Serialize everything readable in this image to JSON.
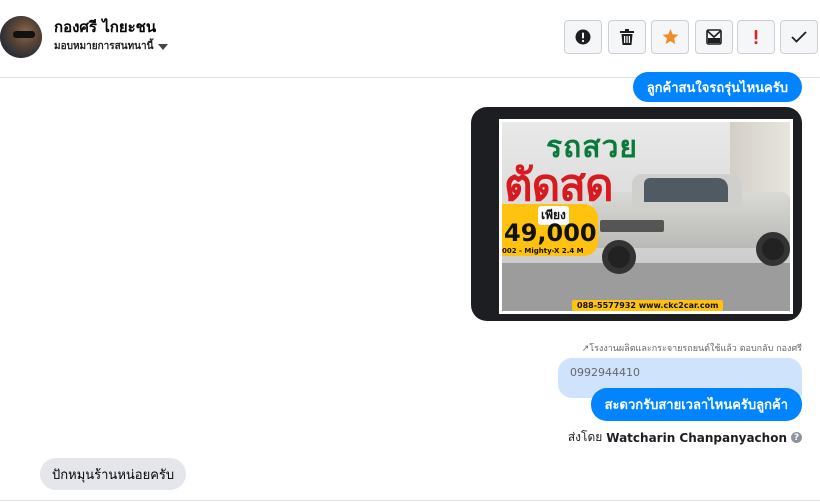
{
  "header": {
    "contact_name": "กองศรี ไกยะชน",
    "assign_label": "มอบหมายการสนทนานี้"
  },
  "toolbar": {
    "buttons": [
      {
        "name": "alert-circle",
        "color": "#1c1e21"
      },
      {
        "name": "trash",
        "color": "#1c1e21"
      },
      {
        "name": "star",
        "color": "#f28c28"
      },
      {
        "name": "archive",
        "color": "#1c1e21"
      },
      {
        "name": "exclamation",
        "color": "#e02020"
      },
      {
        "name": "check",
        "color": "#1c1e21"
      }
    ]
  },
  "messages": {
    "top_outgoing": "ลูกค้าสนใจรถรุ่นไหนครับ",
    "image": {
      "headline1": "รถสวย",
      "headline2": "ตัดสด",
      "price_prefix": "เพียง",
      "price": "49,000",
      "model": "002 - Mighty-X 2.4 M",
      "website": "088-5577932 www.ckc2car.com"
    },
    "reply_meta": "โรงงานผลิตและกระจายรถยนต์ใช้แล้ว ตอบกลับ กองศรี",
    "quoted_text": "0992944410",
    "main_outgoing": "สะดวกรับสายเวลาไหนครับลูกค้า",
    "sent_by_prefix": "ส่งโดย",
    "sent_by_name": "Watcharin Chanpanyachon",
    "incoming": "ปักหมุนร้านหน่อยครับ"
  },
  "colors": {
    "outgoing_bubble": "#0084ff",
    "incoming_bubble": "#e4e6eb",
    "quoted_bubble": "#cfe3fd"
  }
}
